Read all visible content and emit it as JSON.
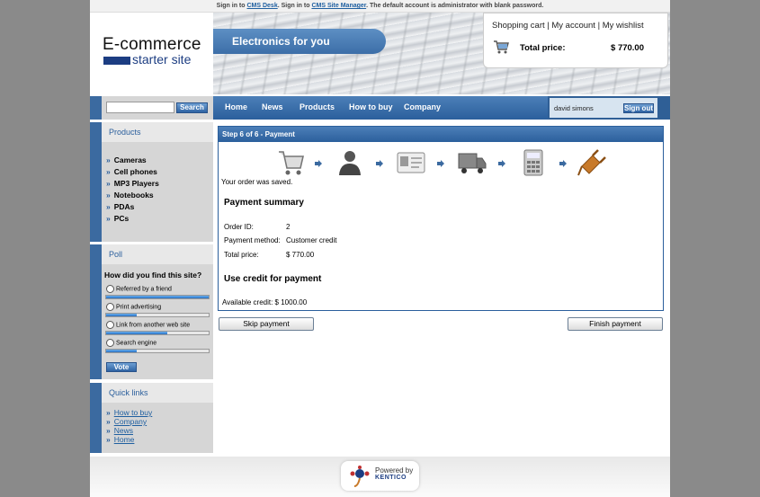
{
  "topbar": {
    "pre": "Sign in to ",
    "link1": "CMS Desk",
    "mid": ". Sign in to ",
    "link2": "CMS Site Manager",
    "post": ". The default account is administrator with blank password."
  },
  "logo": {
    "line1": "E-commerce",
    "line2": "starter site"
  },
  "banner": {
    "slogan": "Electronics for you"
  },
  "cart": {
    "shopping_cart": "Shopping cart",
    "my_account": "My account",
    "my_wishlist": "My wishlist",
    "separator": "|",
    "total_label": "Total price:",
    "total_value": "$ 770.00"
  },
  "search": {
    "value": "",
    "button": "Search"
  },
  "nav": {
    "items": [
      "Home",
      "News",
      "Products",
      "How to buy",
      "Company"
    ]
  },
  "user": {
    "name": "david simons",
    "signout": "Sign out"
  },
  "products": {
    "title": "Products",
    "items": [
      "Cameras",
      "Cell phones",
      "MP3 Players",
      "Notebooks",
      "PDAs",
      "PCs"
    ]
  },
  "poll": {
    "title": "Poll",
    "question": "How did you find this site?",
    "options": [
      {
        "label": "Referred by a friend",
        "fraction": 1.0
      },
      {
        "label": "Print advertising",
        "fraction": 0.3
      },
      {
        "label": "Link from another web site",
        "fraction": 0.6
      },
      {
        "label": "Search engine",
        "fraction": 0.3
      }
    ],
    "vote": "Vote"
  },
  "quicklinks": {
    "title": "Quick links",
    "items": [
      "How to buy",
      "Company",
      "News",
      "Home"
    ]
  },
  "checkout": {
    "step_title": "Step 6 of 6 - Payment",
    "steps": [
      "cart-icon",
      "user-icon",
      "id-card-icon",
      "truck-icon",
      "calculator-icon",
      "plug-icon"
    ],
    "saved": "Your order was saved.",
    "summary_heading": "Payment summary",
    "order_id_label": "Order ID:",
    "order_id_value": "2",
    "method_label": "Payment method:",
    "method_value": "Customer credit",
    "total_label": "Total price:",
    "total_value": "$ 770.00",
    "credit_heading": "Use credit for payment",
    "available_credit": "Available credit: $ 1000.00",
    "skip_button": "Skip payment",
    "finish_button": "Finish payment"
  },
  "footer": {
    "powered": "Powered by",
    "brand": "KENTICO"
  },
  "colors": {
    "accent": "#2b5f9c",
    "sidebar": "#d6d6d6",
    "background": "#8a8a8a"
  }
}
